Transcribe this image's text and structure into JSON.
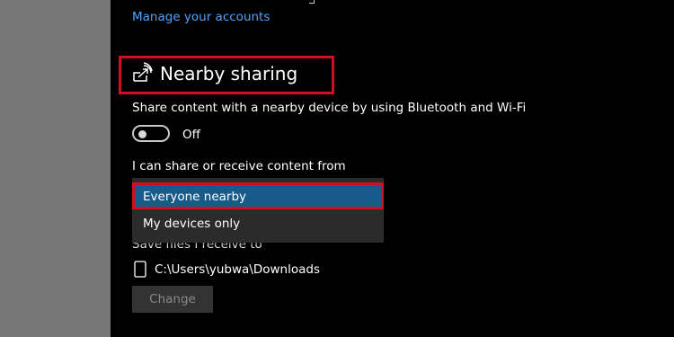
{
  "header": {
    "manage_link": "Manage your accounts"
  },
  "nearby_sharing": {
    "title": "Nearby sharing",
    "icon": "share-signal-icon",
    "description": "Share content with a nearby device by using Bluetooth and Wi-Fi",
    "toggle_state": "Off",
    "share_from_label": "I can share or receive content from",
    "dropdown_options": [
      "Everyone nearby",
      "My devices only"
    ],
    "selected_option": "Everyone nearby",
    "save_files_label": "Save files I receive to",
    "save_path": "C:\\Users\\yubwa\\Downloads",
    "change_button": "Change"
  },
  "colors": {
    "link": "#4ea3ff",
    "selected_option_bg": "#175a8c",
    "highlight": "#d01020"
  }
}
